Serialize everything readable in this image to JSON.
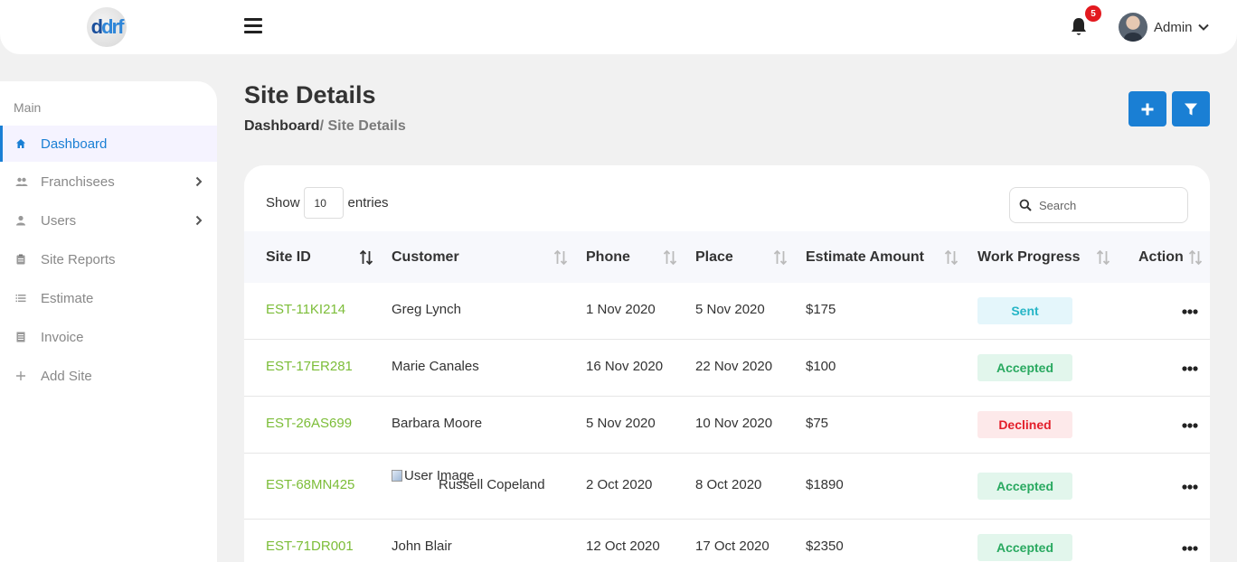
{
  "header": {
    "logo_text": "drf",
    "notification_count": "5",
    "user_name": "Admin"
  },
  "sidebar": {
    "heading": "Main",
    "items": [
      {
        "label": "Dashboard",
        "icon": "home-icon"
      },
      {
        "label": "Franchisees",
        "icon": "people-icon"
      },
      {
        "label": "Users",
        "icon": "person-icon"
      },
      {
        "label": "Site Reports",
        "icon": "clipboard-icon"
      },
      {
        "label": "Estimate",
        "icon": "list-icon"
      },
      {
        "label": "Invoice",
        "icon": "document-icon"
      },
      {
        "label": "Add Site",
        "icon": "plus-icon"
      }
    ]
  },
  "page": {
    "title": "Site Details",
    "breadcrumb_root": "Dashboard",
    "breadcrumb_current": "/ Site Details"
  },
  "table_controls": {
    "show_label": "Show",
    "entries_value": "10",
    "entries_label": "entries",
    "search_placeholder": "Search"
  },
  "table": {
    "columns": [
      "Site ID",
      "Customer",
      "Phone",
      "Place",
      "Estimate Amount",
      "Work Progress",
      "Action"
    ],
    "rows": [
      {
        "site_id": "EST-11KI214",
        "customer": "Greg Lynch",
        "phone": "1 Nov 2020",
        "place": "5 Nov 2020",
        "amount": "$175",
        "status": "Sent"
      },
      {
        "site_id": "EST-17ER281",
        "customer": "Marie Canales",
        "phone": "16 Nov 2020",
        "place": "22 Nov 2020",
        "amount": "$100",
        "status": "Accepted"
      },
      {
        "site_id": "EST-26AS699",
        "customer": "Barbara Moore",
        "phone": "5 Nov 2020",
        "place": "10 Nov 2020",
        "amount": "$75",
        "status": "Declined"
      },
      {
        "site_id": "EST-68MN425",
        "customer": "Russell Copeland",
        "customer_image_alt": "User Image",
        "phone": "2 Oct 2020",
        "place": "8 Oct 2020",
        "amount": "$1890",
        "status": "Accepted"
      },
      {
        "site_id": "EST-71DR001",
        "customer": "John Blair",
        "phone": "12 Oct 2020",
        "place": "17 Oct 2020",
        "amount": "$2350",
        "status": "Accepted"
      }
    ]
  },
  "colors": {
    "accent": "#1a7fd4",
    "link_green": "#7cbd38",
    "sent_bg": "#e4f6fb",
    "sent_fg": "#26b5c6",
    "accepted_bg": "#e2f6ec",
    "accepted_fg": "#29a960",
    "declined_bg": "#fde9ea",
    "declined_fg": "#e31e2a"
  }
}
